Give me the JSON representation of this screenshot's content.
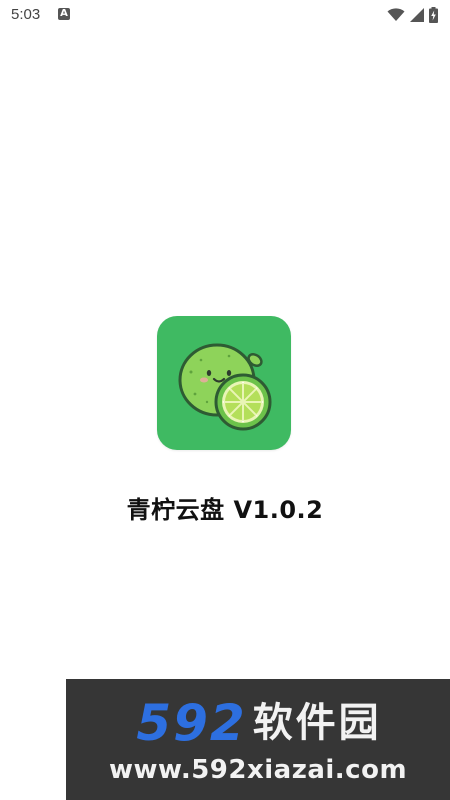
{
  "status_bar": {
    "time": "5:03",
    "notification_icon": "a-icon",
    "right_icons": [
      "wifi-icon",
      "cell-signal-icon",
      "battery-charging-icon"
    ]
  },
  "splash": {
    "app_icon": "lime-logo-icon",
    "app_name": "青柠云盘 V1.0.2"
  },
  "watermark": {
    "brand_number": "592",
    "brand_text": "软件园",
    "url": "www.592xiazai.com"
  },
  "colors": {
    "background": "#ffffff",
    "icon_bg": "#3fba62",
    "lime_body": "#8ed35a",
    "watermark_bg": "#363636",
    "watermark_accent": "#2d6fe0"
  }
}
